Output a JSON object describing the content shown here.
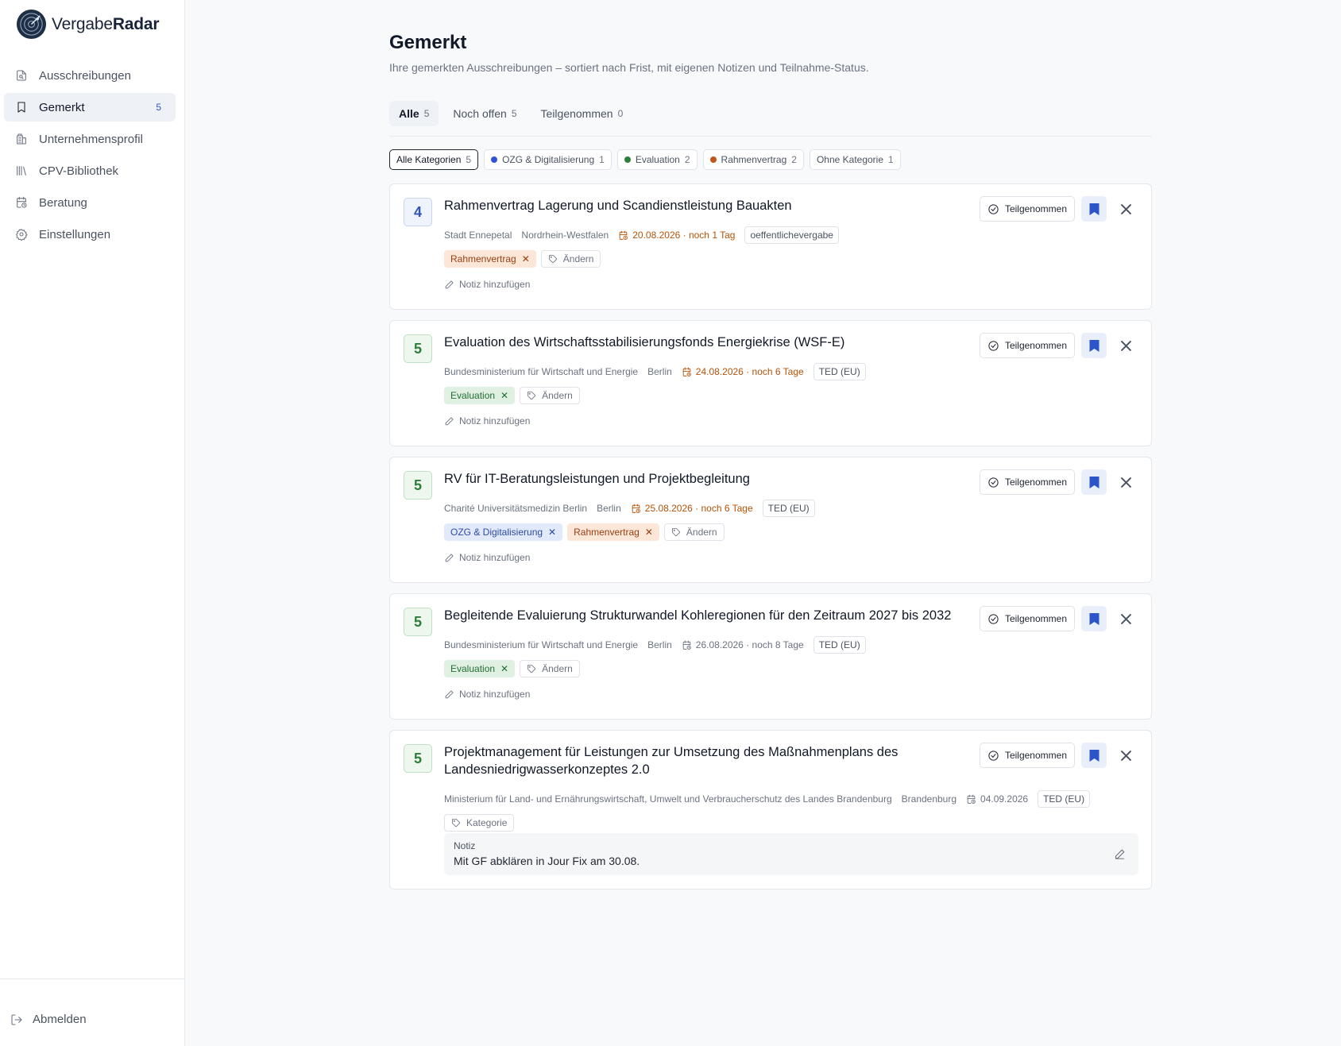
{
  "brand": {
    "name_light": "Vergabe",
    "name_bold": "Radar"
  },
  "nav": [
    {
      "label": "Ausschreibungen",
      "icon": "file-search-icon"
    },
    {
      "label": "Gemerkt",
      "icon": "bookmark-icon",
      "badge": "5",
      "active": true
    },
    {
      "label": "Unternehmensprofil",
      "icon": "building-icon"
    },
    {
      "label": "CPV-Bibliothek",
      "icon": "library-icon"
    },
    {
      "label": "Beratung",
      "icon": "calendar-clock-icon"
    },
    {
      "label": "Einstellungen",
      "icon": "gear-icon"
    }
  ],
  "logout": "Abmelden",
  "page": {
    "title": "Gemerkt",
    "subtitle": "Ihre gemerkten Ausschreibungen – sortiert nach Frist, mit eigenen Notizen und Teilnahme-Status."
  },
  "tabs": [
    {
      "label": "Alle",
      "count": "5"
    },
    {
      "label": "Noch offen",
      "count": "5"
    },
    {
      "label": "Teilgenommen",
      "count": "0"
    }
  ],
  "filters": [
    {
      "label": "Alle Kategorien",
      "count": "5"
    },
    {
      "label": "OZG & Digitalisierung",
      "count": "1",
      "color": "#2f55d4"
    },
    {
      "label": "Evaluation",
      "count": "2",
      "color": "#2e7d3a"
    },
    {
      "label": "Rahmenvertrag",
      "count": "2",
      "color": "#c0571a"
    },
    {
      "label": "Ohne Kategorie",
      "count": "1"
    }
  ],
  "common": {
    "participated_label": "Teilgenommen",
    "add_note_label": "Notiz hinzufügen",
    "edit_tags_label": "Ändern",
    "category_label": "Kategorie",
    "note_heading": "Notiz"
  },
  "cards": [
    {
      "score": "4",
      "title": "Rahmenvertrag Lagerung und Scandienstleistung Bauakten",
      "authority": "Stadt Ennepetal",
      "region": "Nordrhein-Westfalen",
      "deadline": "20.08.2026 · noch 1 Tag",
      "source": "oeffentlichevergabe",
      "tags": [
        "Rahmenvertrag"
      ]
    },
    {
      "score": "5",
      "title": "Evaluation des Wirtschaftsstabilisierungsfonds Energiekrise (WSF-E)",
      "authority": "Bundesministerium für Wirtschaft und Energie",
      "region": "Berlin",
      "deadline": "24.08.2026 · noch 6 Tage",
      "source": "TED (EU)",
      "tags": [
        "Evaluation"
      ]
    },
    {
      "score": "5",
      "title": "RV für IT-Beratungsleistungen und Projektbegleitung",
      "authority": "Charité Universitätsmedizin Berlin",
      "region": "Berlin",
      "deadline": "25.08.2026 · noch 6 Tage",
      "source": "TED (EU)",
      "tags": [
        "OZG & Digitalisierung",
        "Rahmenvertrag"
      ]
    },
    {
      "score": "5",
      "title": "Begleitende Evaluierung Strukturwandel Kohleregionen für den Zeitraum 2027 bis 2032",
      "authority": "Bundesministerium für Wirtschaft und Energie",
      "region": "Berlin",
      "deadline": "26.08.2026 · noch 8 Tage",
      "source": "TED (EU)",
      "tags": [
        "Evaluation"
      ]
    },
    {
      "score": "5",
      "title": "Projektmanagement für Leistungen zur Umsetzung des Maßnahmenplans des Landesniedrigwasserkonzeptes 2.0",
      "authority": "Ministerium für Land- und Ernährungswirtschaft, Umwelt und Verbraucherschutz des Landes Brandenburg",
      "region": "Brandenburg",
      "deadline": "04.09.2026",
      "source": "TED (EU)",
      "tags": [],
      "note": "Mit GF abklären in Jour Fix am 30.08."
    }
  ]
}
